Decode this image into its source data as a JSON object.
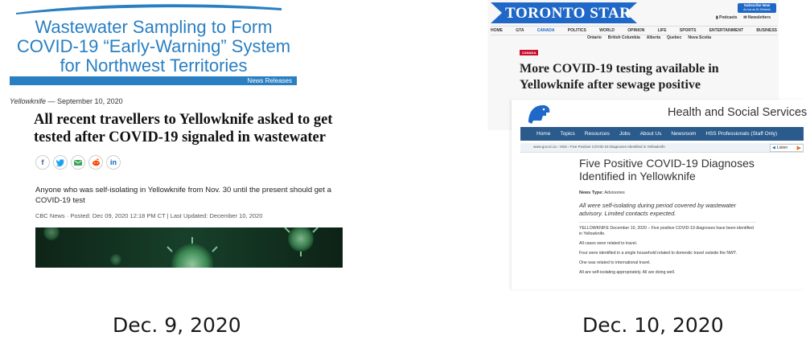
{
  "news_release": {
    "title": "Wastewater Sampling to Form COVID-19 “Early-Warning” System for Northwest Territories",
    "section_label": "News Releases",
    "dateline_place": "Yellowknife",
    "dateline_date": " — September 10, 2020",
    "accent_color": "#2a7fc2"
  },
  "cbc_article": {
    "headline": "All recent travellers to Yellowknife asked to get tested after COVID-19 signaled in wastewater",
    "share_icons": [
      "facebook-icon",
      "twitter-icon",
      "email-icon",
      "reddit-icon",
      "linkedin-icon"
    ],
    "summary": "Anyone who was self-isolating in Yellowknife from Nov. 30 until the present should get a COVID-19 test",
    "byline": "CBC News · Posted: Dec 09, 2020 12:18 PM CT | Last Updated: December 10, 2020"
  },
  "captions": {
    "left": "Dec. 9, 2020",
    "right": "Dec. 10, 2020"
  },
  "toronto_star": {
    "logo": "TORONTO STAR",
    "subscribe": "Subscribe Now",
    "subscribe_sub": "As low as $1.50/week",
    "util_links": [
      "Podcasts",
      "Newsletters"
    ],
    "nav": [
      "HOME",
      "GTA",
      "CANADA",
      "POLITICS",
      "WORLD",
      "OPINION",
      "LIFE",
      "SPORTS",
      "ENTERTAINMENT",
      "BUSINESS"
    ],
    "subnav": [
      "Ontario",
      "British Columbia",
      "Alberta",
      "Quebec",
      "Nova Scotia"
    ],
    "section_tag": "CANADA",
    "headline": "More COVID-19 testing available in Yellowknife after sewage positive",
    "brand_color": "#1f68c7"
  },
  "hss": {
    "header_title": "Health and Social Services",
    "nav": [
      "Home",
      "Topics",
      "Resources",
      "Jobs",
      "About Us",
      "Newsroom",
      "HSS Professionals (Staff Only)"
    ],
    "breadcrumb": "www.gov.nt.ca › HSS › Five Positive COVID-19 Diagnoses Identified in Yellowknife",
    "listen": "Listen",
    "title": "Five Positive COVID-19 Diagnoses Identified in Yellowknife",
    "news_type_label": "News Type:",
    "news_type_value": "Advisories",
    "lede": "All were self-isolating during period covered by wastewater advisory. Limited contacts expected.",
    "body": [
      "YELLOWKNIFE December 10, 2020 – Five positive COVID-19 diagnoses have been identified in Yellowknife.",
      "All cases were related to travel.",
      "Four were identified in a single household related to domestic travel outside the NWT.",
      "One was related to international travel.",
      "All are self-isolating appropriately. All are doing well."
    ],
    "nav_color": "#2a5b8c"
  }
}
